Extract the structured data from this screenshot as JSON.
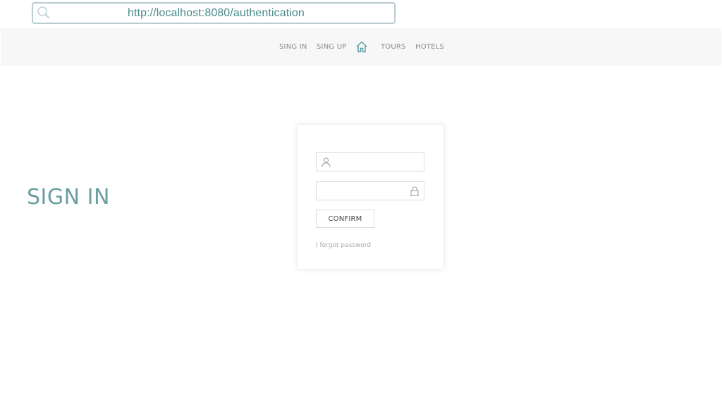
{
  "browser": {
    "url": "http://localhost:8080/authentication"
  },
  "nav": {
    "items": [
      {
        "label": "SING IN"
      },
      {
        "label": "SING UP"
      },
      {
        "label": "TOURS"
      },
      {
        "label": "HOTELS"
      }
    ],
    "home_icon": "home-icon"
  },
  "page": {
    "heading": "SIGN IN"
  },
  "form": {
    "username": {
      "value": "",
      "placeholder": "",
      "icon": "user-icon"
    },
    "password": {
      "value": "",
      "placeholder": "",
      "icon": "lock-icon"
    },
    "confirm_label": "CONFIRM",
    "forgot_label": "I forgot password"
  },
  "colors": {
    "accent": "#6a9ea3",
    "url_text": "#4a8a8c",
    "nav_bg": "#f7f7f7"
  }
}
